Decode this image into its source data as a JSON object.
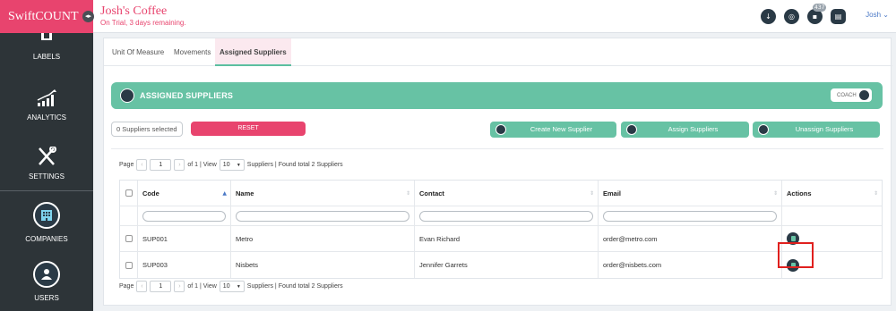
{
  "brand": "SwiftCOUNT",
  "company": {
    "name": "Josh's Coffee",
    "trial": "On Trial, 3 days remaining."
  },
  "topbar": {
    "icons": [
      "download-icon",
      "globe-icon",
      "notifications-icon",
      "clipboard-icon"
    ],
    "notification_count": "437",
    "user": "Josh",
    "user_caret": "⌄"
  },
  "sidebar": {
    "items": [
      {
        "label": "LABELS",
        "icon": "labels-icon"
      },
      {
        "label": "ANALYTICS",
        "icon": "analytics-icon"
      },
      {
        "label": "SETTINGS",
        "icon": "settings-icon"
      },
      {
        "label": "COMPANIES",
        "icon": "companies-icon"
      },
      {
        "label": "USERS",
        "icon": "users-icon"
      }
    ]
  },
  "tabs": [
    "Unit Of Measure",
    "Movements",
    "Assigned Suppliers"
  ],
  "header": {
    "title": "ASSIGNED SUPPLIERS",
    "coach": "COACH"
  },
  "actions": {
    "selected_count": "0 Suppliers selected",
    "reset": "RESET",
    "create": "Create New Supplier",
    "assign": "Assign Suppliers",
    "unassign": "Unassign Suppliers"
  },
  "pager": {
    "page_label": "Page",
    "prev": "‹",
    "page": "1",
    "next": "›",
    "of_text": "of 1 | View",
    "per_page": "10",
    "caret": "▼",
    "summary": "Suppliers | Found total 2 Suppliers"
  },
  "table": {
    "columns": [
      "Code",
      "Name",
      "Contact",
      "Email",
      "Actions"
    ],
    "rows": [
      {
        "code": "SUP001",
        "name": "Metro",
        "contact": "Evan Richard",
        "email": "order@metro.com"
      },
      {
        "code": "SUP003",
        "name": "Nisbets",
        "contact": "Jennifer Garrets",
        "email": "order@nisbets.com"
      }
    ]
  },
  "colors": {
    "brand": "#e8446e",
    "accent": "#67c2a4",
    "dark": "#2d3438",
    "highlight": "#e0201e"
  }
}
